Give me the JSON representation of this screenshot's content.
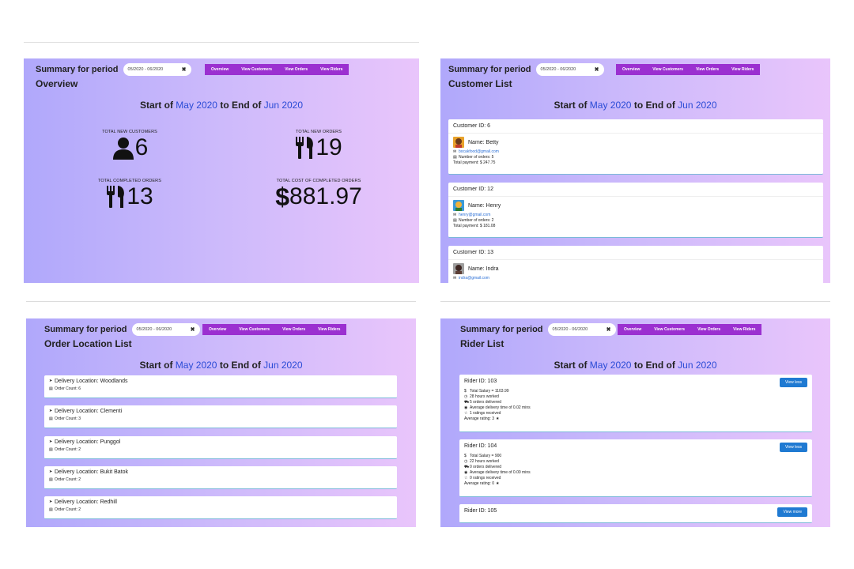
{
  "header": {
    "summary_label": "Summary for period",
    "period_value": "05/2020 - 06/2020",
    "clear_icon": "✖",
    "nav": [
      "Overview",
      "View Customers",
      "View Orders",
      "View Riders"
    ]
  },
  "range": {
    "start": "Start of",
    "from": "May 2020",
    "mid": "to End of",
    "to": "Jun 2020"
  },
  "overview": {
    "title": "Overview",
    "stats": [
      {
        "label": "TOTAL NEW CUSTOMERS",
        "value": "6",
        "icon": "user-icon"
      },
      {
        "label": "TOTAL NEW ORDERS",
        "value": "19",
        "icon": "utensils-icon"
      },
      {
        "label": "TOTAL COMPLETED ORDERS",
        "value": "13",
        "icon": "utensils-icon"
      },
      {
        "label": "TOTAL COST OF COMPLETED ORDERS",
        "value": "881.97",
        "prefix": "$",
        "icon": "dollar-icon"
      }
    ]
  },
  "customers": {
    "title": "Customer List",
    "items": [
      {
        "id": "Customer ID: 6",
        "name": "Name: Betty",
        "email": "bocakfood@gmail.com",
        "orders": "Number of orders: 5",
        "payment": "Total payment:  $  247.75"
      },
      {
        "id": "Customer ID: 12",
        "name": "Name: Henry",
        "email": "henry@gmail.com",
        "orders": "Number of orders: 2",
        "payment": "Total payment:  $  181.08"
      },
      {
        "id": "Customer ID: 13",
        "name": "Name: Indra",
        "email": "indra@gmail.com",
        "orders": "",
        "payment": ""
      }
    ]
  },
  "orders": {
    "title": "Order Location List",
    "items": [
      {
        "loc": "Delivery Location: Woodlands",
        "count": "Order Count: 6"
      },
      {
        "loc": "Delivery Location: Clementi",
        "count": "Order Count: 3"
      },
      {
        "loc": "Delivery Location: Punggol",
        "count": "Order Count: 2"
      },
      {
        "loc": "Delivery Location: Bukit Batok",
        "count": "Order Count: 2"
      },
      {
        "loc": "Delivery Location: Redhill",
        "count": "Order Count: 2"
      }
    ]
  },
  "riders": {
    "title": "Rider List",
    "items": [
      {
        "id": "Rider ID: 103",
        "button": "View less",
        "salary": "Total Salary = 1103.99",
        "hours": "28 hours worked",
        "delivered": "5 orders delivered",
        "avg_time": "Average delivery time of 0.02 mins",
        "ratings": "1 ratings received",
        "avg_rating": "Average rating: 3"
      },
      {
        "id": "Rider ID: 104",
        "button": "View less",
        "salary": "Total Salary = 900",
        "hours": "22 hours worked",
        "delivered": "0 orders delivered",
        "avg_time": "Average delivery time of 0.00 mins",
        "ratings": "0 ratings received",
        "avg_rating": "Average rating: 0"
      },
      {
        "id": "Rider ID: 105",
        "button": "View more"
      }
    ]
  }
}
